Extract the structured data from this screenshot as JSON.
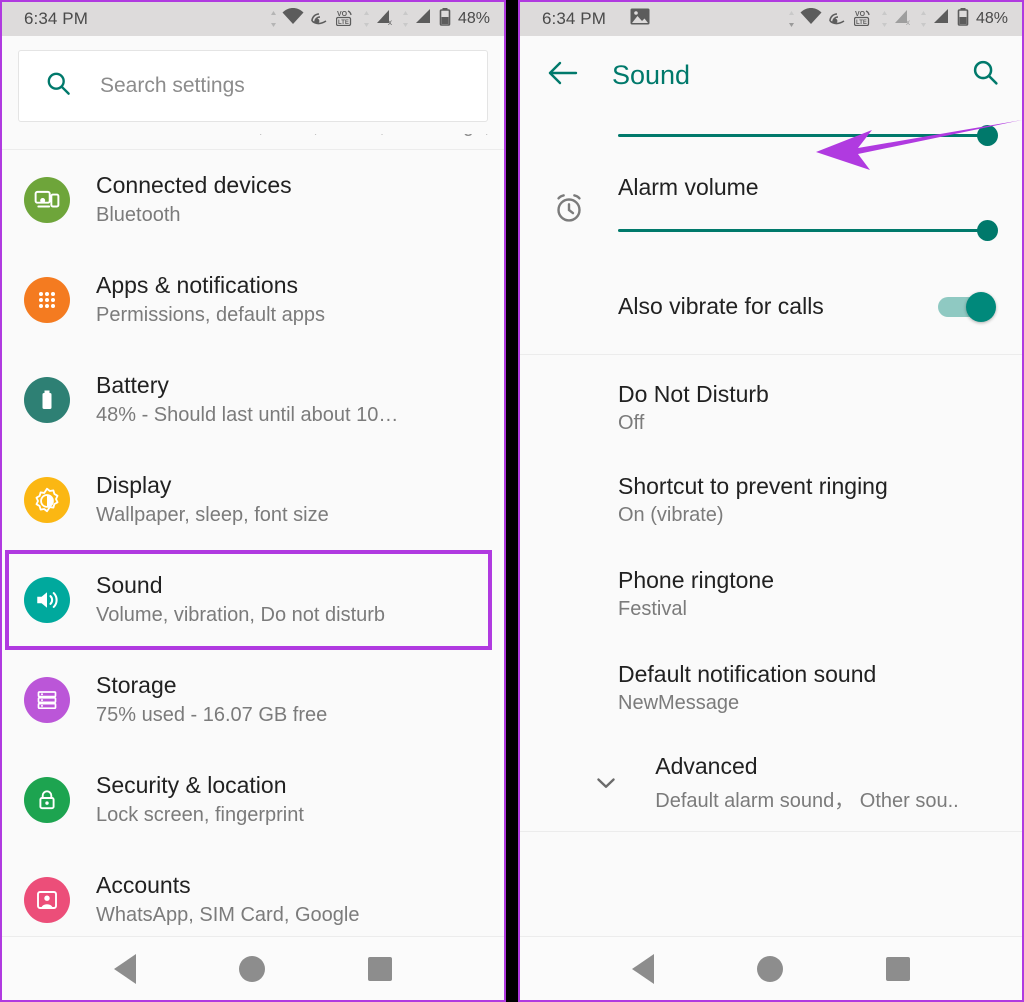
{
  "colors": {
    "annotation_purple": "#b03ae0",
    "accent_teal": "#00796b",
    "status_bar_bg": "#dddbdb",
    "panel_bg": "#fafafa"
  },
  "status_bar": {
    "time": "6:34 PM",
    "battery_percent": "48%",
    "icons": [
      "image-icon",
      "wifi-icon",
      "hotspot-icon",
      "volte-icon",
      "signal-no-service-icon",
      "signal-icon",
      "battery-icon"
    ]
  },
  "left_phone": {
    "search": {
      "placeholder": "Search settings",
      "icon": "search-icon"
    },
    "cut_off_row_text": "Network & internet, Wi-Fi, mobile, data usage, hotspot",
    "items": [
      {
        "title": "Connected devices",
        "subtitle": "Bluetooth",
        "icon": "connected-devices-icon",
        "icon_color": "#6ea53a"
      },
      {
        "title": "Apps & notifications",
        "subtitle": "Permissions, default apps",
        "icon": "apps-grid-icon",
        "icon_color": "#f47b20"
      },
      {
        "title": "Battery",
        "subtitle": "48% - Should last until about 10…",
        "icon": "battery-icon",
        "icon_color": "#2e8074"
      },
      {
        "title": "Display",
        "subtitle": "Wallpaper, sleep, font size",
        "icon": "brightness-icon",
        "icon_color": "#fbb713"
      },
      {
        "title": "Sound",
        "subtitle": "Volume, vibration, Do not disturb",
        "icon": "volume-icon",
        "icon_color": "#00a99d",
        "highlighted": true
      },
      {
        "title": "Storage",
        "subtitle": "75% used - 16.07 GB free",
        "icon": "storage-icon",
        "icon_color": "#bb56d8"
      },
      {
        "title": "Security & location",
        "subtitle": "Lock screen, fingerprint",
        "icon": "lock-icon",
        "icon_color": "#1da450"
      },
      {
        "title": "Accounts",
        "subtitle": "WhatsApp, SIM Card, Google",
        "icon": "account-icon",
        "icon_color": "#ec4e79"
      }
    ]
  },
  "right_phone": {
    "appbar": {
      "title": "Sound",
      "back_icon": "back-arrow-icon",
      "search_icon": "search-icon"
    },
    "top_slider": {
      "label": "",
      "value_percent": 100,
      "cut_off": true
    },
    "alarm_slider": {
      "label": "Alarm volume",
      "icon": "alarm-clock-icon",
      "value_percent": 100
    },
    "vibrate_toggle": {
      "label": "Also vibrate for calls",
      "state": "on"
    },
    "items": [
      {
        "title": "Do Not Disturb",
        "subtitle": "Off",
        "annotated": true
      },
      {
        "title": "Shortcut to prevent ringing",
        "subtitle": "On (vibrate)"
      },
      {
        "title": "Phone ringtone",
        "subtitle": "Festival"
      },
      {
        "title": "Default notification sound",
        "subtitle": "NewMessage"
      }
    ],
    "advanced": {
      "title": "Advanced",
      "subtitle": "Default alarm sound， Other sou..",
      "icon": "chevron-down-icon"
    }
  },
  "nav_bar": {
    "back": "back-triangle-icon",
    "home": "home-circle-icon",
    "recents": "recents-square-icon"
  }
}
